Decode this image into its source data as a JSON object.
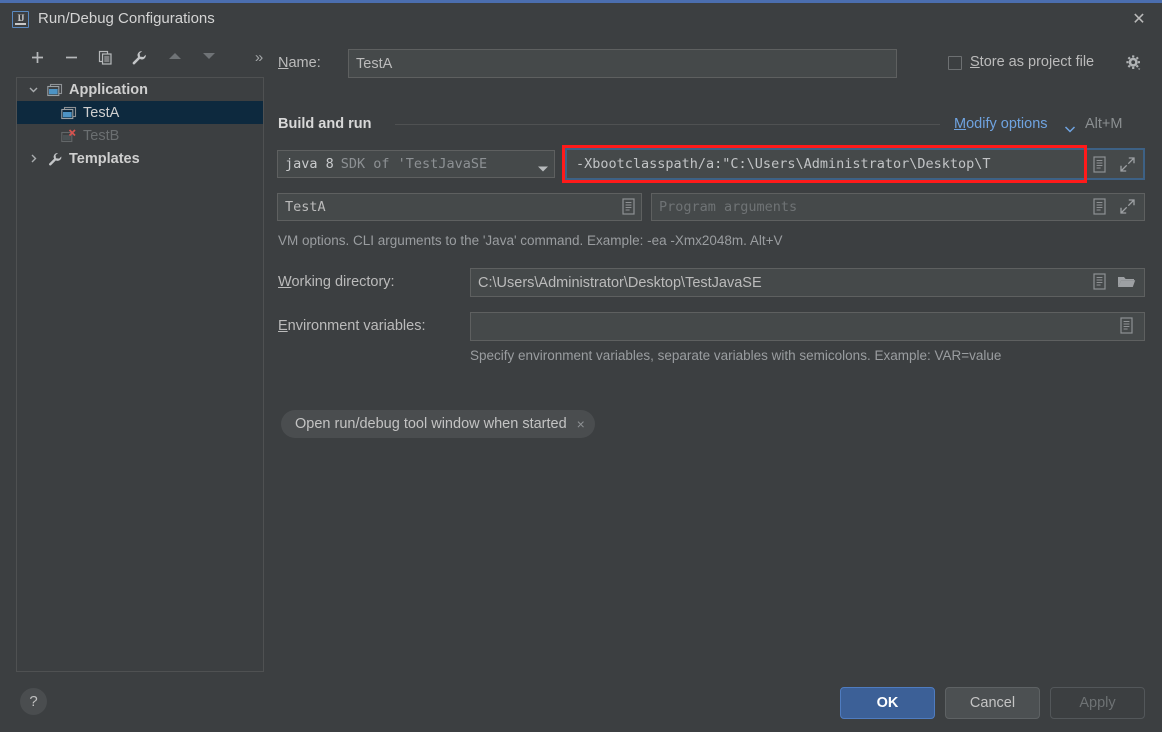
{
  "window": {
    "title": "Run/Debug Configurations",
    "app_icon": "intellij-idea-icon",
    "close_label": "✕"
  },
  "toolbar": {
    "items": [
      {
        "name": "add-configuration-button",
        "icon": "plus-icon",
        "enabled": true
      },
      {
        "name": "remove-configuration-button",
        "icon": "minus-icon",
        "enabled": true
      },
      {
        "name": "copy-configuration-button",
        "icon": "copy-icon",
        "enabled": true
      },
      {
        "name": "edit-templates-button",
        "icon": "wrench-icon",
        "enabled": true
      },
      {
        "name": "move-up-button",
        "icon": "arrow-up-icon",
        "enabled": false
      },
      {
        "name": "move-down-button",
        "icon": "arrow-down-icon",
        "enabled": false
      },
      {
        "name": "more-options-button",
        "icon": "chevron-double-right-icon",
        "enabled": true
      }
    ],
    "overflow_label": "»"
  },
  "tree": {
    "nodes": [
      {
        "label": "Application",
        "type": "group",
        "expanded": true,
        "icon": "application-folder-icon"
      },
      {
        "label": "TestA",
        "type": "config",
        "selected": true,
        "icon": "application-icon",
        "error": false
      },
      {
        "label": "TestB",
        "type": "config",
        "selected": false,
        "icon": "application-error-icon",
        "error": true
      },
      {
        "label": "Templates",
        "type": "group",
        "expanded": false,
        "icon": "wrench-icon"
      }
    ]
  },
  "form": {
    "name_label": "Name:",
    "name_label_mnemonic": "N",
    "name_value": "TestA",
    "store_as_project_file_label": "Store as project file",
    "store_as_project_file_mnemonic": "S",
    "store_as_project_file_checked": false,
    "store_gear_icon": "gear-icon",
    "section_title": "Build and run",
    "modify_options_label": "Modify options",
    "modify_options_mnemonic": "M",
    "modify_options_shortcut": "Alt+M",
    "jre_value_strong": "java 8",
    "jre_value_dim": "SDK of 'TestJavaSE",
    "vm_options_value": "-Xbootclasspath/a:\"C:\\Users\\Administrator\\Desktop\\T",
    "main_class_value": "TestA",
    "program_arguments_placeholder": "Program arguments",
    "vm_options_hint": "VM options. CLI arguments to the 'Java' command. Example: -ea -Xmx2048m. Alt+V",
    "working_directory_label": "Working directory:",
    "working_directory_mnemonic": "W",
    "working_directory_value": "C:\\Users\\Administrator\\Desktop\\TestJavaSE",
    "environment_variables_label": "Environment variables:",
    "environment_variables_mnemonic": "E",
    "environment_variables_value": "",
    "environment_variables_hint": "Specify environment variables, separate variables with semicolons. Example: VAR=value",
    "chip_label": "Open run/debug tool window when started",
    "chip_close": "×"
  },
  "footer": {
    "help_label": "?",
    "ok_label": "OK",
    "cancel_label": "Cancel",
    "apply_label": "Apply",
    "apply_enabled": false
  },
  "annotation": {
    "color": "#ff1a1a",
    "target": "vm-options-field"
  },
  "colors": {
    "dialog_bg": "#3c3f41",
    "field_bg": "#45494a",
    "accent_blue": "#4b6eaf",
    "link_blue": "#6fa3e0",
    "selection_blue": "#0d293e",
    "annotation_red": "#ff1a1a"
  }
}
